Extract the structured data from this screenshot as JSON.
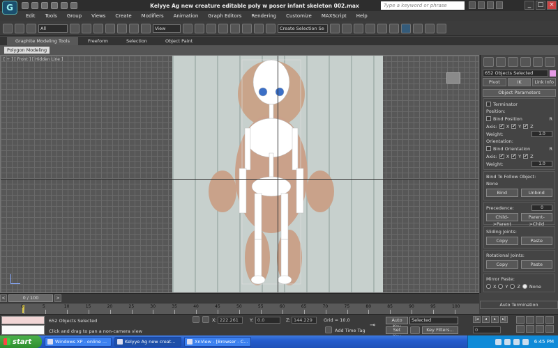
{
  "window": {
    "title": "Kelyye Ag new creature  editable poly w poser infant skeleton 002.max",
    "search_placeholder": "Type a keyword or phrase",
    "controls": [
      "_",
      "□",
      "×"
    ]
  },
  "menu": [
    "Edit",
    "Tools",
    "Group",
    "Views",
    "Create",
    "Modifiers",
    "Animation",
    "Graph Editors",
    "Rendering",
    "Customize",
    "MAXScript",
    "Help"
  ],
  "toolbar": {
    "filter_select": "All",
    "coord_system": "View",
    "named_selection": "Create Selection Se"
  },
  "ribbon": {
    "tabs": [
      "Graphite Modeling Tools",
      "Freeform",
      "Selection",
      "Object Paint"
    ],
    "active_chip": "Polygon Modeling"
  },
  "viewport": {
    "label": "[ + ] [ Front ] [ Hidden Line ]"
  },
  "command_panel": {
    "selection": "652 Objects Selected",
    "selection_color": "#e59be6",
    "tabs": [
      "Pivot",
      "IK",
      "Link Info"
    ],
    "rollout_title": "Object Parameters",
    "terminator": "Terminator",
    "position_label": "Position:",
    "bind_position": "Bind Position",
    "axis_label": "Axis:",
    "axes": [
      "X",
      "Y",
      "Z"
    ],
    "weight_label": "Weight:",
    "weight_value": "1.0",
    "orientation_label": "Orientation:",
    "bind_orientation": "Bind Orientation",
    "r_label": "R",
    "bind_follow_label": "Bind To Follow Object:",
    "bind_follow_value": "None",
    "bind_btn": "Bind",
    "unbind_btn": "Unbind",
    "precedence_label": "Precedence:",
    "precedence_value": "0",
    "child_parent": "Child->Parent",
    "parent_child": "Parent->Child",
    "sliding_joints": "Sliding Joints:",
    "rotational_joints": "Rotational Joints:",
    "copy": "Copy",
    "paste": "Paste",
    "mirror_paste": "Mirror Paste:",
    "mirror_options": [
      "X",
      "Y",
      "Z",
      "None"
    ],
    "auto_termination": "Auto Termination"
  },
  "timeline": {
    "frame_display": "0 / 100",
    "ticks": [
      0,
      5,
      10,
      15,
      20,
      25,
      30,
      35,
      40,
      45,
      50,
      55,
      60,
      65,
      70,
      75,
      80,
      85,
      90,
      95,
      100
    ]
  },
  "status": {
    "selection_text": "652 Objects Selected",
    "prompt": "Click and drag to pan a non-camera view",
    "x_label": "X:",
    "x_value": "222.261",
    "y_label": "Y:",
    "y_value": "0.0",
    "z_label": "Z:",
    "z_value": "144.229",
    "grid": "Grid = 10.0",
    "add_time_tag": "Add Time Tag",
    "auto_key": "Auto Key",
    "auto_key_mode": "Selected",
    "set_key": "Set Key",
    "key_filters": "Key Filters...",
    "frame_field": "0"
  },
  "taskbar": {
    "start": "start",
    "tasks": [
      "Windows XP - online ...",
      "Kelyye Ag new creat...",
      "XnView - [Browser - C..."
    ],
    "clock": "6:45 PM"
  }
}
